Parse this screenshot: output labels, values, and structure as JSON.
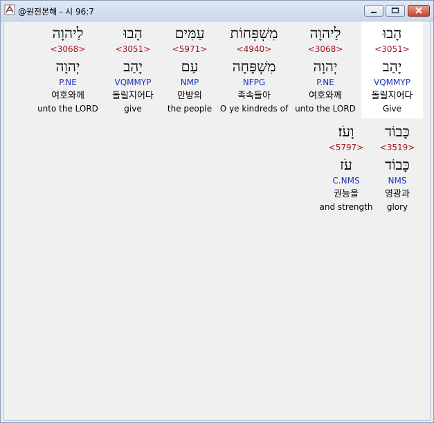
{
  "window": {
    "title": "@원전본해 - 시 96:7"
  },
  "row1": [
    {
      "heb": "הָבוּ",
      "strong": "<3051>",
      "lex": "יָהַב",
      "morph": "VQMMYP",
      "kor": "돌릴지어다",
      "eng": "Give"
    },
    {
      "heb": "לַיהוָה",
      "strong": "<3068>",
      "lex": "יְהוָה",
      "morph": "P.NE",
      "kor": "여호와께",
      "eng": "unto the LORD"
    },
    {
      "heb": "מִשְׁפְּחוֹת",
      "strong": "<4940>",
      "lex": "מִשְׁפָּחָה",
      "morph": "NFPG",
      "kor": "족속들아",
      "eng": "O ye kindreds of"
    },
    {
      "heb": "עַמִּים",
      "strong": "<5971>",
      "lex": "עַם",
      "morph": "NMP",
      "kor": "만방의",
      "eng": "the people"
    },
    {
      "heb": "הָבוּ",
      "strong": "<3051>",
      "lex": "יָהַב",
      "morph": "VQMMYP",
      "kor": "돌릴지어다",
      "eng": "give"
    },
    {
      "heb": "לַיהוָה",
      "strong": "<3068>",
      "lex": "יְהוָה",
      "morph": "P.NE",
      "kor": "여호와께",
      "eng": "unto the LORD"
    }
  ],
  "row2": [
    {
      "heb": "כָּבוֹד",
      "strong": "<3519>",
      "lex": "כָּבוֹד",
      "morph": "NMS",
      "kor": "영광과",
      "eng": "glory"
    },
    {
      "heb": "וָעֹז׃",
      "strong": "<5797>",
      "lex": "עֹז",
      "morph": "C.NMS",
      "kor": "권능을",
      "eng": "and strength"
    }
  ]
}
